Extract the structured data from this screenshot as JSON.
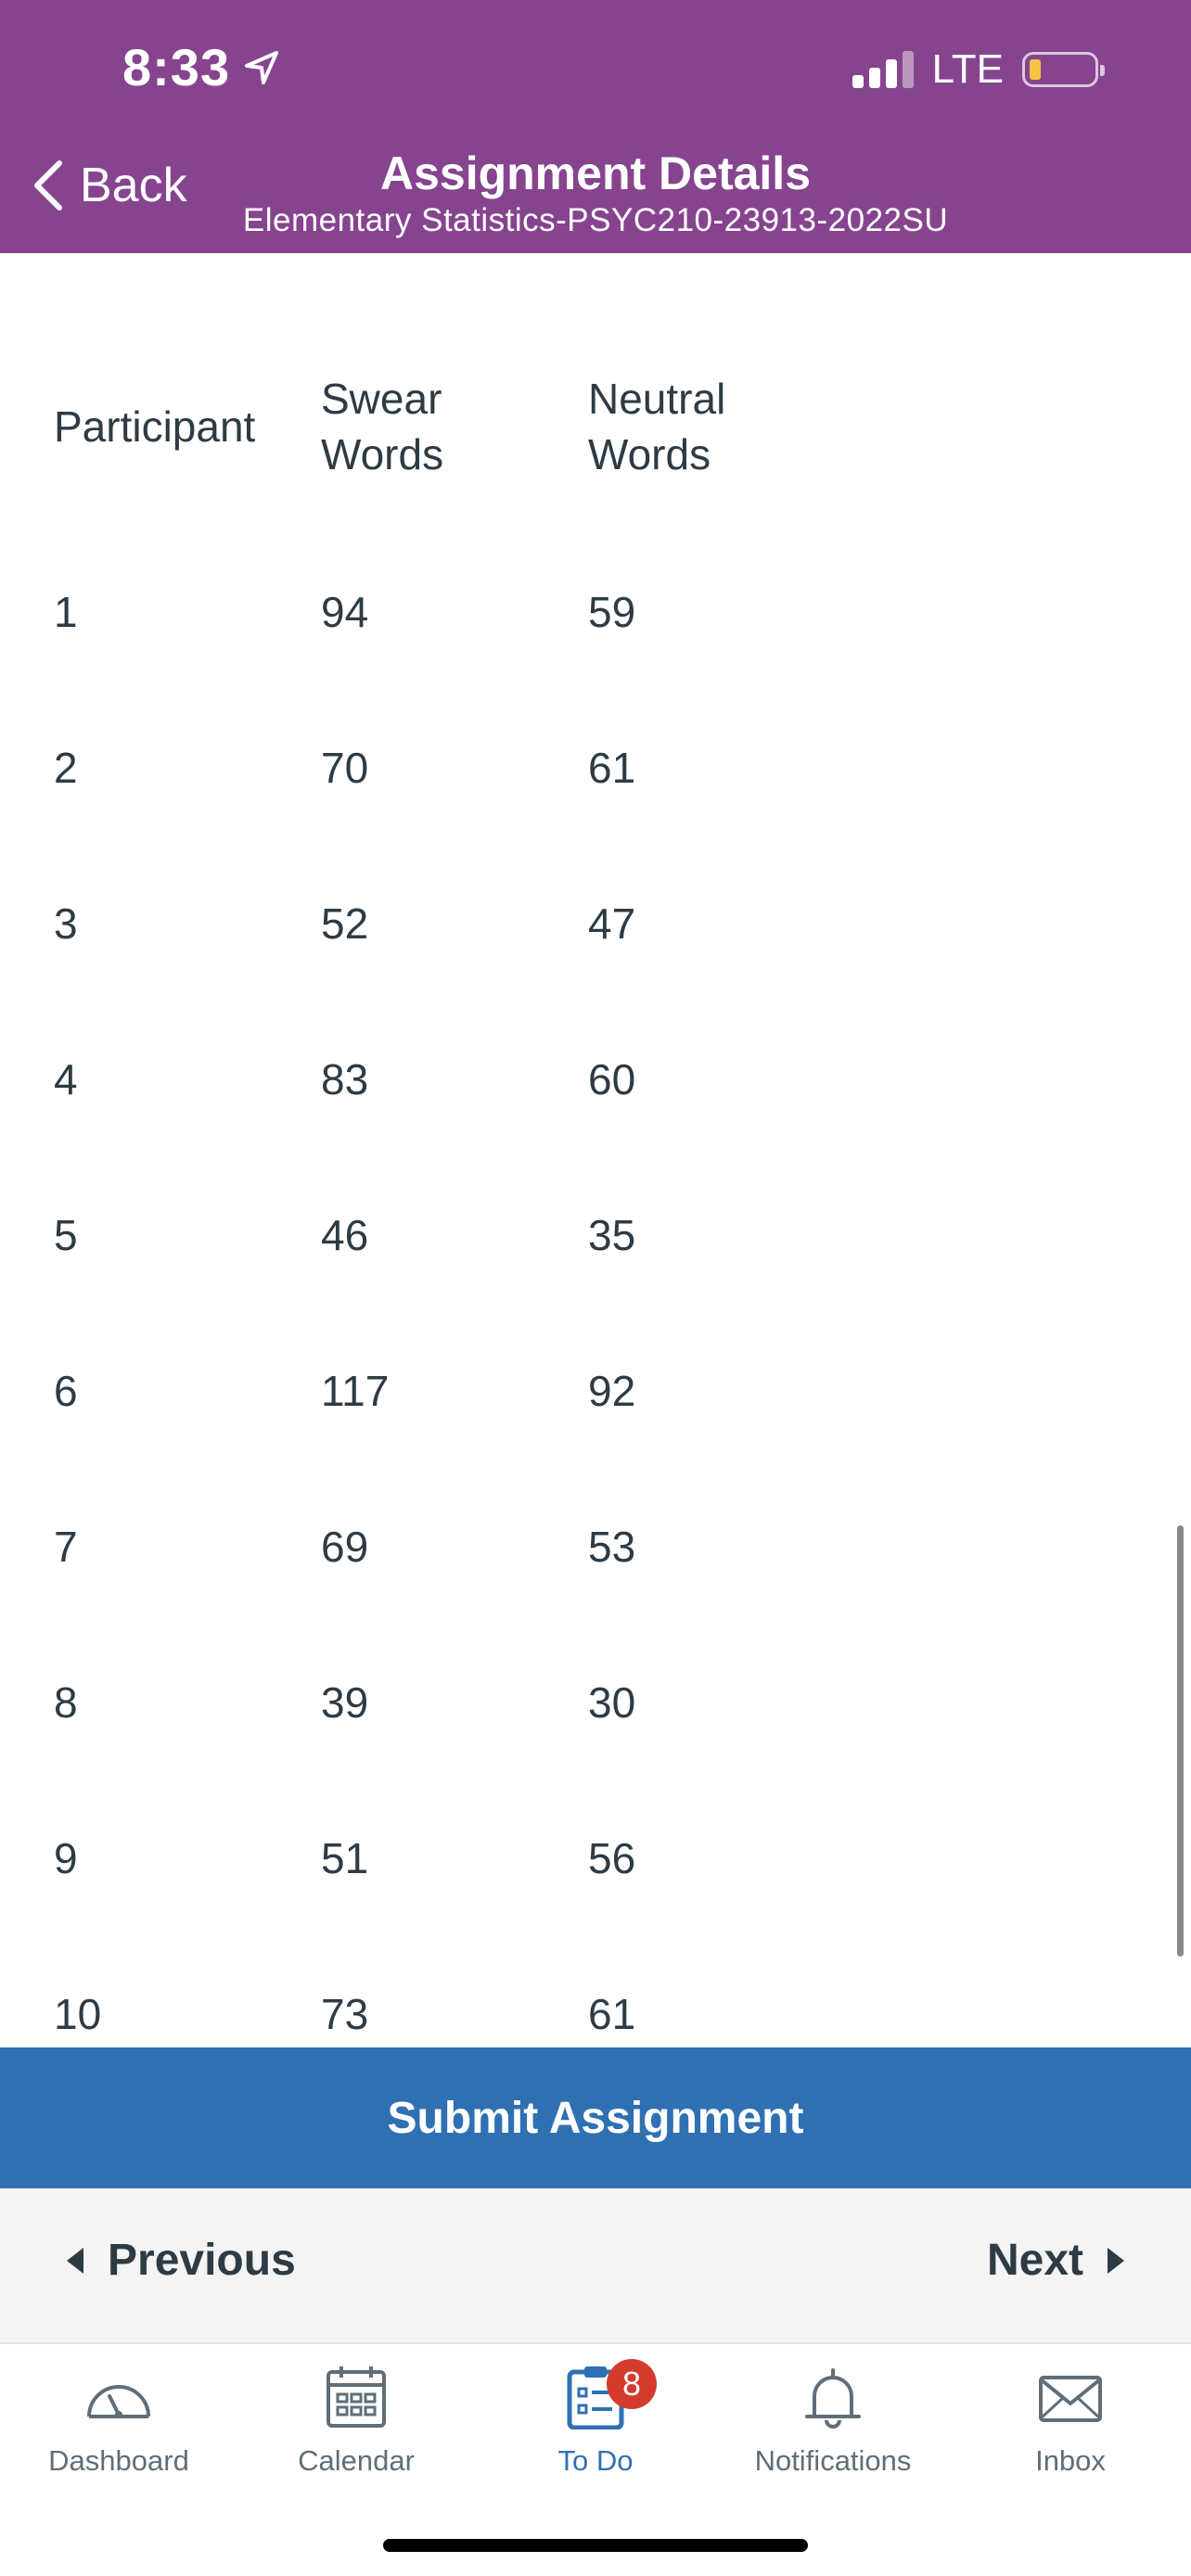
{
  "status_bar": {
    "time": "8:33",
    "network": "LTE"
  },
  "header": {
    "back_label": "Back",
    "title": "Assignment Details",
    "subtitle": "Elementary Statistics-PSYC210-23913-2022SU"
  },
  "table": {
    "headers": {
      "c1": "Participant",
      "c2_line1": "Swear",
      "c2_line2": "Words",
      "c3_line1": "Neutral",
      "c3_line2": "Words"
    },
    "rows": [
      [
        "1",
        "94",
        "59"
      ],
      [
        "2",
        "70",
        "61"
      ],
      [
        "3",
        "52",
        "47"
      ],
      [
        "4",
        "83",
        "60"
      ],
      [
        "5",
        "46",
        "35"
      ],
      [
        "6",
        "117",
        "92"
      ],
      [
        "7",
        "69",
        "53"
      ],
      [
        "8",
        "39",
        "30"
      ],
      [
        "9",
        "51",
        "56"
      ],
      [
        "10",
        "73",
        "61"
      ]
    ]
  },
  "actions": {
    "submit_label": "Submit Assignment",
    "previous_label": "Previous",
    "next_label": "Next"
  },
  "tabbar": {
    "tabs": [
      {
        "label": "Dashboard",
        "icon": "dashboard-gauge-icon"
      },
      {
        "label": "Calendar",
        "icon": "calendar-icon"
      },
      {
        "label": "To Do",
        "icon": "clipboard-todo-icon",
        "badge": "8"
      },
      {
        "label": "Notifications",
        "icon": "bell-icon"
      },
      {
        "label": "Inbox",
        "icon": "envelope-icon"
      }
    ]
  },
  "colors": {
    "header_bg": "#86448f",
    "submit_bg": "#2f70b3",
    "active_tab": "#2f70b3",
    "badge": "#d43b2d"
  }
}
